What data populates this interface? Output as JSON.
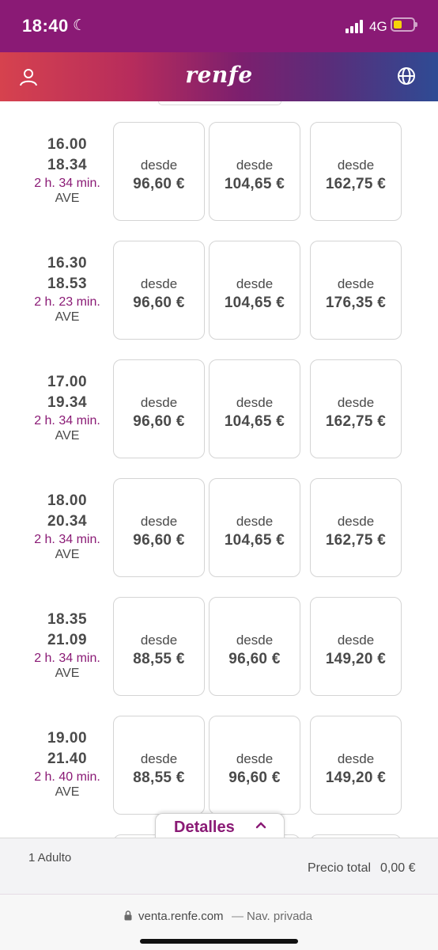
{
  "status_bar": {
    "time": "18:40",
    "network": "4G"
  },
  "header": {
    "logo": "renfe"
  },
  "card_label": "desde",
  "trains": [
    {
      "departure": "16.00",
      "arrival": "18.34",
      "duration": "2 h. 34 min.",
      "type": "AVE",
      "prices": [
        "96,60 €",
        "104,65 €",
        "162,75 €"
      ]
    },
    {
      "departure": "16.30",
      "arrival": "18.53",
      "duration": "2 h. 23 min.",
      "type": "AVE",
      "prices": [
        "96,60 €",
        "104,65 €",
        "176,35 €"
      ]
    },
    {
      "departure": "17.00",
      "arrival": "19.34",
      "duration": "2 h. 34 min.",
      "type": "AVE",
      "prices": [
        "96,60 €",
        "104,65 €",
        "162,75 €"
      ]
    },
    {
      "departure": "18.00",
      "arrival": "20.34",
      "duration": "2 h. 34 min.",
      "type": "AVE",
      "prices": [
        "96,60 €",
        "104,65 €",
        "162,75 €"
      ]
    },
    {
      "departure": "18.35",
      "arrival": "21.09",
      "duration": "2 h. 34 min.",
      "type": "AVE",
      "prices": [
        "88,55 €",
        "96,60 €",
        "149,20 €"
      ]
    },
    {
      "departure": "19.00",
      "arrival": "21.40",
      "duration": "2 h. 40 min.",
      "type": "AVE",
      "prices": [
        "88,55 €",
        "96,60 €",
        "149,20 €"
      ]
    }
  ],
  "details": {
    "label": "Detalles"
  },
  "summary": {
    "passengers": "1 Adulto",
    "total_label": "Precio total",
    "total_value": "0,00 €"
  },
  "browser": {
    "url": "venta.renfe.com",
    "separator": "—",
    "mode": "Nav. privada"
  }
}
